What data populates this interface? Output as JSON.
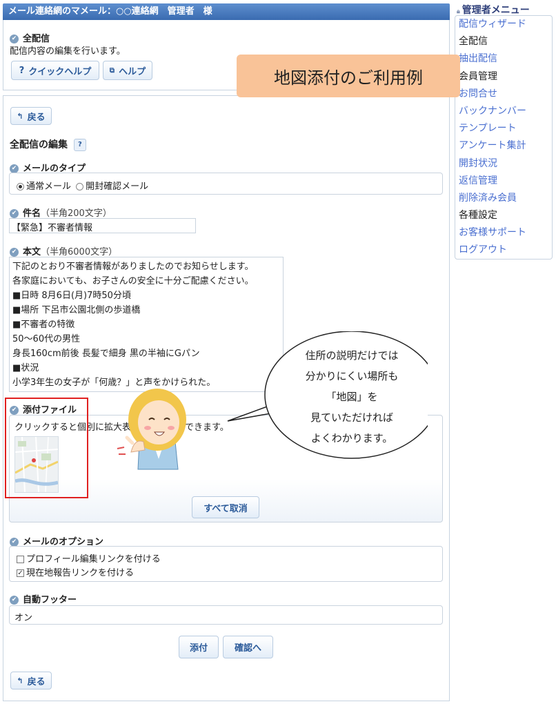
{
  "header": {
    "title": "メール連絡網のマメール：○○連絡網　管理者　様"
  },
  "intro": {
    "heading": "全配信",
    "description": "配信内容の編集を行います。",
    "quick_help_label": "クイックヘルプ",
    "help_label": "ヘルプ"
  },
  "main": {
    "back_label": "戻る",
    "edit_title": "全配信の編集",
    "mail_type": {
      "label": "メールのタイプ",
      "options": [
        "通常メール",
        "開封確認メール"
      ],
      "selected": "通常メール"
    },
    "subject": {
      "label": "件名",
      "hint": "（半角200文字）",
      "value": "【緊急】不審者情報"
    },
    "body": {
      "label": "本文",
      "hint": "（半角6000文字）",
      "lines": [
        "下記のとおり不審者情報がありましたのでお知らせします。",
        "各家庭においても、お子さんの安全に十分ご配慮ください。",
        "■日時 8月6日(月)7時50分頃",
        "■場所 下呂市公園北側の歩道橋",
        "■不審者の特徴",
        "50～60代の男性",
        "身長160cm前後 長髪で細身 黒の半袖にGパン",
        "■状況",
        "小学3年生の女子が「何歳？」と声をかけられた。"
      ]
    },
    "attachment": {
      "label": "添付ファイル",
      "note": "クリックすると個別に拡大表示することができます。",
      "cancel_all_label": "すべて取消"
    },
    "options": {
      "label": "メールのオプション",
      "items": [
        {
          "label": "プロフィール編集リンクを付ける",
          "checked": false
        },
        {
          "label": "現在地報告リンクを付ける",
          "checked": true
        }
      ]
    },
    "footer": {
      "label": "自動フッター",
      "value": "オン"
    },
    "attach_label": "添付",
    "confirm_label": "確認へ"
  },
  "sidebar": {
    "title": "管理者メニュー",
    "items": [
      {
        "label": "配信ウィザード",
        "link": true
      },
      {
        "label": "全配信",
        "link": false
      },
      {
        "label": "抽出配信",
        "link": true
      },
      {
        "label": "会員管理",
        "link": false
      },
      {
        "label": "お問合せ",
        "link": true
      },
      {
        "label": "バックナンバー",
        "link": true
      },
      {
        "label": "テンプレート",
        "link": true
      },
      {
        "label": "アンケート集計",
        "link": true
      },
      {
        "label": "開封状況",
        "link": true
      },
      {
        "label": "返信管理",
        "link": true
      },
      {
        "label": "削除済み会員",
        "link": true
      },
      {
        "label": "各種設定",
        "link": false
      },
      {
        "label": "お客様サポート",
        "link": true
      },
      {
        "label": "ログアウト",
        "link": true
      }
    ]
  },
  "overlay": {
    "banner": "地図添付のご利用例",
    "speech_lines": [
      "住所の説明だけでは",
      "分かりにくい場所も",
      "「地図」を",
      "見ていただければ",
      "よくわかります。"
    ]
  },
  "colors": {
    "accent": "#3a6bb0",
    "highlight_red": "#e02020",
    "banner": "#f9c398",
    "link": "#4a6fd0"
  }
}
